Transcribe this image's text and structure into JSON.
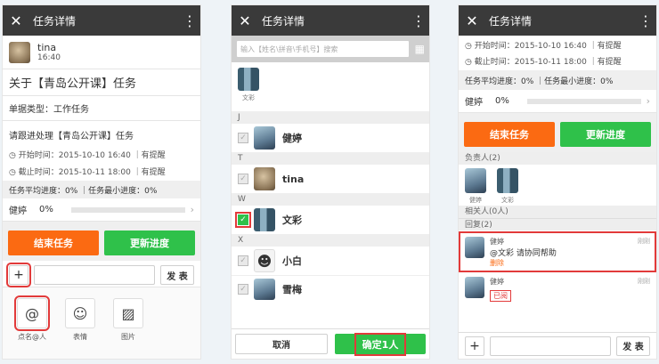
{
  "screen1": {
    "title": "任务详情",
    "user": {
      "name": "tina",
      "time": "16:40"
    },
    "heading": "关于【青岛公开课】任务",
    "type_label": "单据类型：工作任务",
    "request": "请跟进处理【青岛公开课】任务",
    "start": "开始时间：2015-10-10 16:40 ｜有提醒",
    "end": "截止时间：2015-10-11 18:00 ｜有提醒",
    "progress": "任务平均进度：0% ｜任务最小进度：0%",
    "member": {
      "name": "健婷",
      "percent": "0%"
    },
    "end_btn": "结束任务",
    "update_btn": "更新进度",
    "send_btn": "发 表",
    "tools": [
      {
        "label": "点名@人",
        "icon": "at-icon"
      },
      {
        "label": "表情",
        "icon": "smile-icon"
      },
      {
        "label": "图片",
        "icon": "image-icon"
      }
    ]
  },
  "screen2": {
    "title": "任务详情",
    "search_placeholder": "输入【姓名\\拼音\\手机号】搜索",
    "selected_name": "文彩",
    "groups": [
      {
        "letter": "J",
        "name": "健婷",
        "checked": false
      },
      {
        "letter": "T",
        "name": "tina",
        "checked": false
      },
      {
        "letter": "W",
        "name": "文彩",
        "checked": true
      },
      {
        "letter": "X",
        "name": "小白",
        "checked": false
      },
      {
        "letter": "",
        "name": "雪梅",
        "checked": false
      }
    ],
    "cancel_btn": "取消",
    "confirm_btn": "确定1人"
  },
  "screen3": {
    "title": "任务详情",
    "start": "开始时间：2015-10-10 16:40 ｜有提醒",
    "end": "截止时间：2015-10-11 18:00 ｜有提醒",
    "progress": "任务平均进度：0% ｜任务最小进度：0%",
    "member": {
      "name": "健婷",
      "percent": "0%"
    },
    "end_btn": "结束任务",
    "update_btn": "更新进度",
    "owner_label": "负责人(2)",
    "owners": [
      "健婷",
      "文彩"
    ],
    "related_label": "相关人(0人)",
    "reply_label": "回复(2)",
    "replies": [
      {
        "name": "健婷",
        "time": "刚刚",
        "text": "@文彩 请协同帮助",
        "action": "删除"
      },
      {
        "name": "健婷",
        "time": "刚刚",
        "text": "",
        "action": "已阅"
      }
    ],
    "send_btn": "发 表"
  }
}
